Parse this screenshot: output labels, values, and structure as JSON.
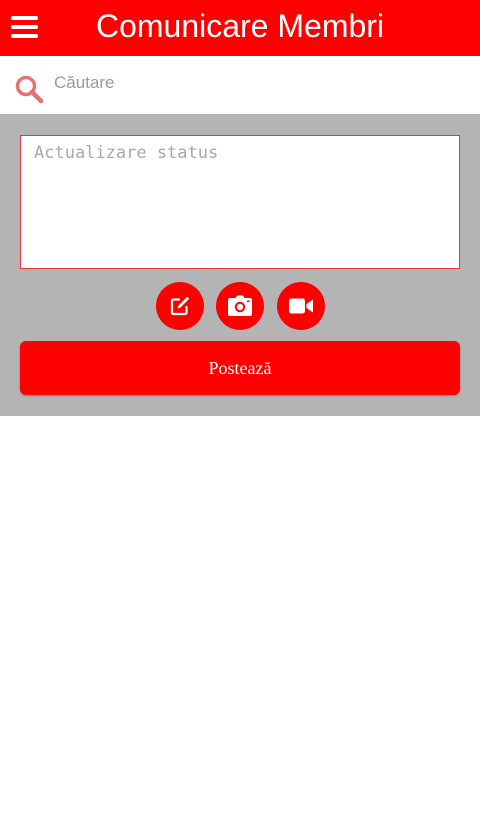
{
  "app_bar": {
    "title": "Comunicare Membri"
  },
  "search": {
    "placeholder": "Căutare"
  },
  "post_panel": {
    "status_placeholder": "Actualizare status",
    "buttons": [
      {
        "icon": "edit-icon"
      },
      {
        "icon": "camera-icon"
      },
      {
        "icon": "video-camera-icon"
      }
    ],
    "post_label": "Postează"
  },
  "colors": {
    "primary": "#fe0000",
    "panel_background": "#b4b4b4",
    "search_icon": "#e57373",
    "text_area_border": "#e53935"
  }
}
